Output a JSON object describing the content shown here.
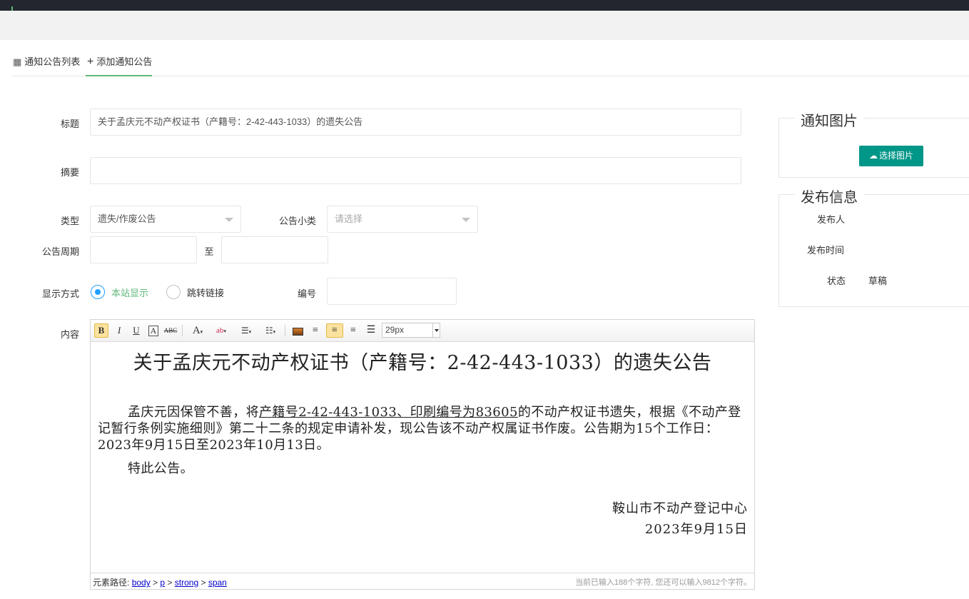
{
  "tabs": [
    {
      "label": "通知公告列表",
      "icon": "table-icon"
    },
    {
      "label": "添加通知公告",
      "icon": "plus-icon"
    }
  ],
  "form": {
    "title_label": "标题",
    "title_value": "关于孟庆元不动产权证书（产籍号：2-42-443-1033）的遗失公告",
    "summary_label": "摘要",
    "summary_value": "",
    "type_label": "类型",
    "type_value": "遗失/作废公告",
    "subtype_label": "公告小类",
    "subtype_placeholder": "请选择",
    "period_label": "公告周期",
    "period_to": "至",
    "display_label": "显示方式",
    "display_options": [
      "本站显示",
      "跳转链接"
    ],
    "display_selected": "本站显示",
    "number_label": "编号",
    "content_label": "内容"
  },
  "editor": {
    "font_size": "29px",
    "doc_title": "关于孟庆元不动产权证书（产籍号：2-42-443-1033）的遗失公告",
    "body_pre": "孟庆元因保管不善，将",
    "body_underlined": "产籍号2-42-443-1033、印刷编号为83605",
    "body_post": "的不动产权证书遗失，根据《不动产登记暂行条例实施细则》第二十二条的规定申请补发，现公告该不动产权属证书作废。公告期为15个工作日：  2023年9月15日至2023年10月13日。",
    "body_p2": "特此公告。",
    "sign_org": "鞍山市不动产登记中心",
    "sign_date": "2023年9月15日",
    "path_label": "元素路径:",
    "path": [
      "body",
      "p",
      "strong",
      "span"
    ],
    "char_count": "当前已输入188个字符, 您还可以输入9812个字符。"
  },
  "side": {
    "image_title": "通知图片",
    "upload_label": "选择图片",
    "publish_title": "发布信息",
    "publisher_label": "发布人",
    "publish_time_label": "发布时间",
    "status_label": "状态",
    "status_value": "草稿"
  },
  "colors": {
    "accent": "#5fb878",
    "primary": "#009688",
    "radio": "#1e9fff",
    "topbar": "#23262e"
  }
}
